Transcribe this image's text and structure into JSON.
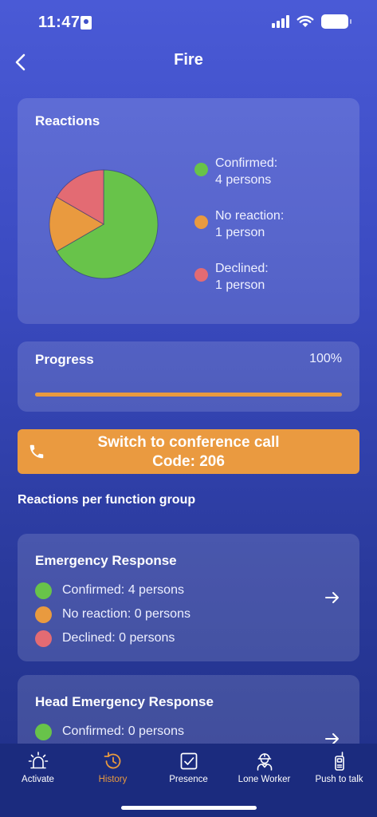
{
  "status_bar": {
    "time": "11:47"
  },
  "header": {
    "title": "Fire"
  },
  "colors": {
    "confirmed": "#68c34a",
    "no_reaction": "#e99a3f",
    "declined": "#e36b73",
    "accent": "#ea9a40"
  },
  "reactions": {
    "title": "Reactions",
    "legend": [
      {
        "line1": "Confirmed:",
        "line2": "4 persons",
        "color": "#68c34a"
      },
      {
        "line1": "No reaction:",
        "line2": "1 person",
        "color": "#e99a3f"
      },
      {
        "line1": "Declined:",
        "line2": "1 person",
        "color": "#e36b73"
      }
    ]
  },
  "chart_data": {
    "type": "pie",
    "categories": [
      "Confirmed",
      "No reaction",
      "Declined"
    ],
    "values": [
      4,
      1,
      1
    ],
    "colors": [
      "#68c34a",
      "#e99a3f",
      "#e36b73"
    ],
    "title": "Reactions"
  },
  "progress": {
    "label": "Progress",
    "percent_text": "100%",
    "value": 100
  },
  "conference": {
    "line1": "Switch to conference call",
    "line2": "Code: 206",
    "icon": "phone-icon"
  },
  "function_groups": {
    "title": "Reactions per function group",
    "groups": [
      {
        "name": "Emergency Response",
        "rows": [
          {
            "text": "Confirmed: 4 persons",
            "color": "#68c34a"
          },
          {
            "text": "No reaction: 0 persons",
            "color": "#e99a3f"
          },
          {
            "text": "Declined: 0 persons",
            "color": "#e36b73"
          }
        ]
      },
      {
        "name": "Head Emergency Response",
        "rows": [
          {
            "text": "Confirmed: 0 persons",
            "color": "#68c34a"
          }
        ]
      }
    ]
  },
  "bottom_nav": {
    "tabs": [
      {
        "label": "Activate",
        "icon": "alarm-icon",
        "active": false
      },
      {
        "label": "History",
        "icon": "history-icon",
        "active": true
      },
      {
        "label": "Presence",
        "icon": "checkbox-icon",
        "active": false
      },
      {
        "label": "Lone Worker",
        "icon": "worker-icon",
        "active": false
      },
      {
        "label": "Push to talk",
        "icon": "walkie-talkie-icon",
        "active": false
      }
    ]
  }
}
